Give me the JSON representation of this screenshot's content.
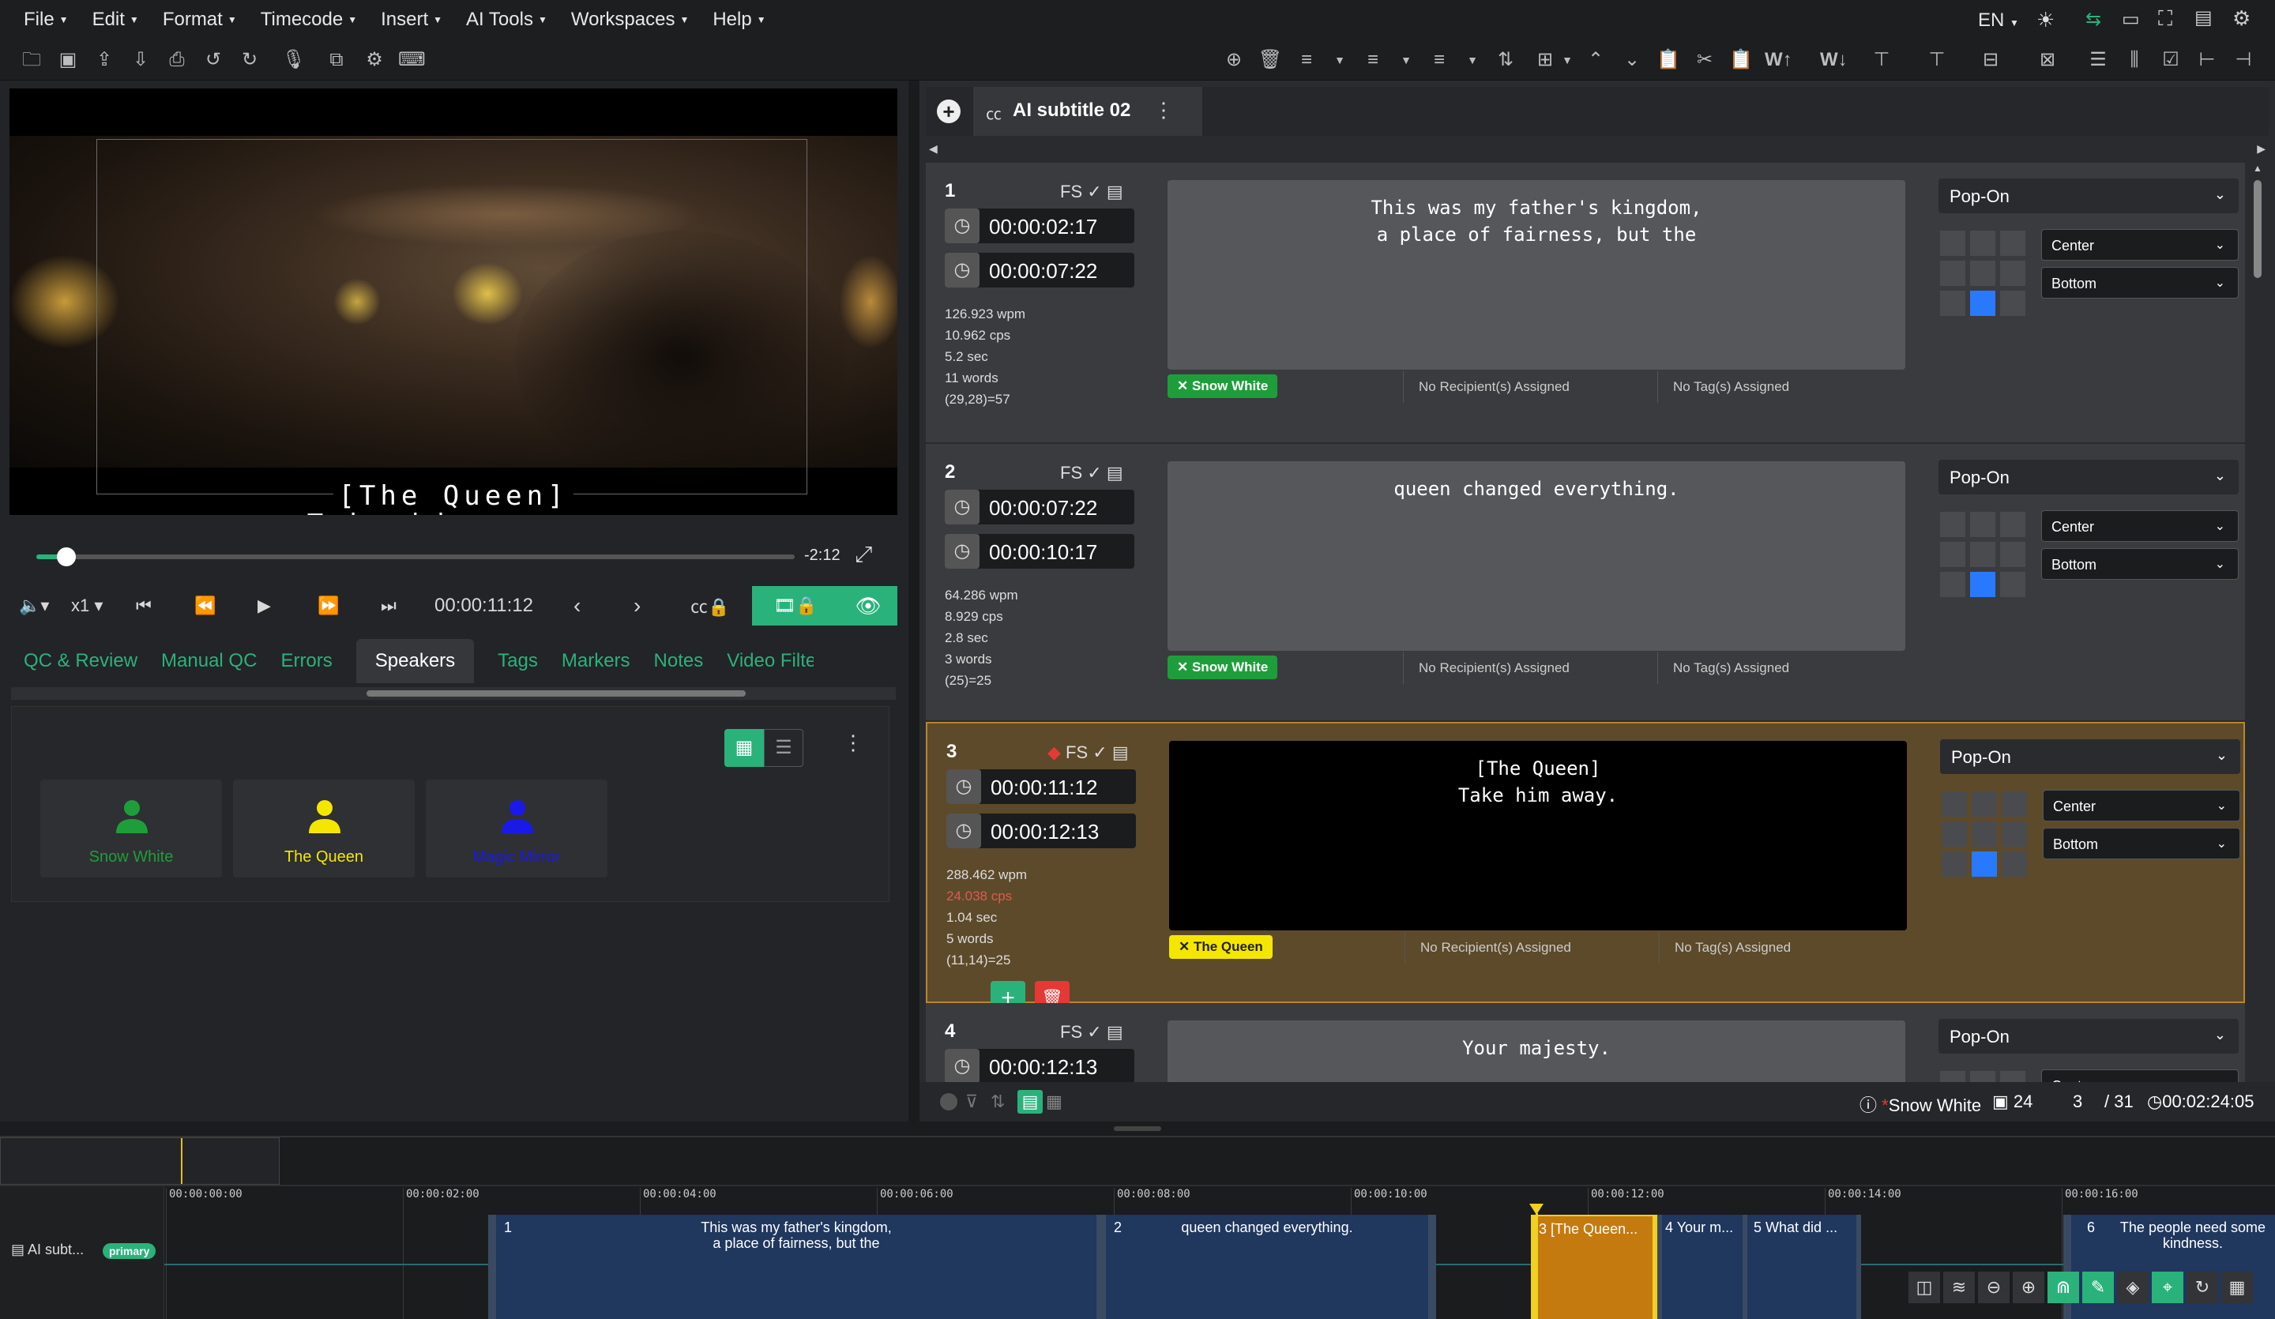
{
  "menu": [
    "File",
    "Edit",
    "Format",
    "Timecode",
    "Insert",
    "AI Tools",
    "Workspaces",
    "Help"
  ],
  "menu_right": {
    "lang": "EN"
  },
  "player": {
    "subtitle_line1": "[The Queen]",
    "subtitle_line2": "Take him away.",
    "remaining": "-2:12",
    "progress": 0.04,
    "speed": "x1",
    "current_tc": "00:00:11:12"
  },
  "left_tabs": [
    "QC & Review",
    "Manual QC",
    "Errors",
    "Speakers",
    "Tags",
    "Markers",
    "Notes",
    "Video Filte"
  ],
  "speakers": [
    {
      "name": "Snow White",
      "color": "#1e9e3a"
    },
    {
      "name": "The Queen",
      "color": "#f5e600"
    },
    {
      "name": "Magic Mirror",
      "color": "#1a1ae8"
    }
  ],
  "track_tab": {
    "label": "AI subtitle 02"
  },
  "cues": [
    {
      "num": "1",
      "fs": "FS",
      "in": "00:00:02:17",
      "out": "00:00:07:22",
      "wpm": "126.923 wpm",
      "cps": "10.962 cps",
      "dur": "5.2 sec",
      "words": "11 words",
      "chars": "(29,28)=57",
      "text": "This was my father's kingdom,\na place of fairness, but the",
      "speaker": "Snow White",
      "recipients": "No Recipient(s) Assigned",
      "tags": "No Tag(s) Assigned",
      "mode": "Pop-On",
      "h": "Center",
      "v": "Bottom"
    },
    {
      "num": "2",
      "fs": "FS",
      "in": "00:00:07:22",
      "out": "00:00:10:17",
      "wpm": "64.286 wpm",
      "cps": "8.929 cps",
      "dur": "2.8 sec",
      "words": "3 words",
      "chars": "(25)=25",
      "text": "queen changed everything.",
      "speaker": "Snow White",
      "recipients": "No Recipient(s) Assigned",
      "tags": "No Tag(s) Assigned",
      "mode": "Pop-On",
      "h": "Center",
      "v": "Bottom"
    },
    {
      "num": "3",
      "fs": "FS",
      "in": "00:00:11:12",
      "out": "00:00:12:13",
      "wpm": "288.462 wpm",
      "cps": "24.038 cps",
      "dur": "1.04 sec",
      "words": "5 words",
      "chars": "(11,14)=25",
      "text": "[The Queen]\nTake him away.",
      "speaker": "The Queen",
      "recipients": "No Recipient(s) Assigned",
      "tags": "No Tag(s) Assigned",
      "mode": "Pop-On",
      "h": "Center",
      "v": "Bottom"
    },
    {
      "num": "4",
      "fs": "FS",
      "in": "00:00:12:13",
      "text": "Your majesty.",
      "mode": "Pop-On",
      "h": "Center"
    }
  ],
  "status": {
    "speaker": "Snow White",
    "count": "24",
    "index": "3",
    "total": "/ 31",
    "duration": "00:02:24:05"
  },
  "timeline": {
    "ticks": [
      "00:00:00:00",
      "00:00:02:00",
      "00:00:04:00",
      "00:00:06:00",
      "00:00:08:00",
      "00:00:10:00",
      "00:00:12:00",
      "00:00:14:00",
      "00:00:16:00"
    ],
    "track_label": "AI subt...",
    "track_badge": "primary",
    "segments": [
      {
        "num": "1",
        "text": "This was my father's kingdom,\na place of fairness, but the"
      },
      {
        "num": "2",
        "text": "queen changed everything."
      },
      {
        "num": "3",
        "text": "[The Queen..."
      },
      {
        "num": "4",
        "text": "Your m..."
      },
      {
        "num": "5",
        "text": "What did ..."
      },
      {
        "num": "6",
        "text": "The people need some\nkindness."
      }
    ]
  }
}
